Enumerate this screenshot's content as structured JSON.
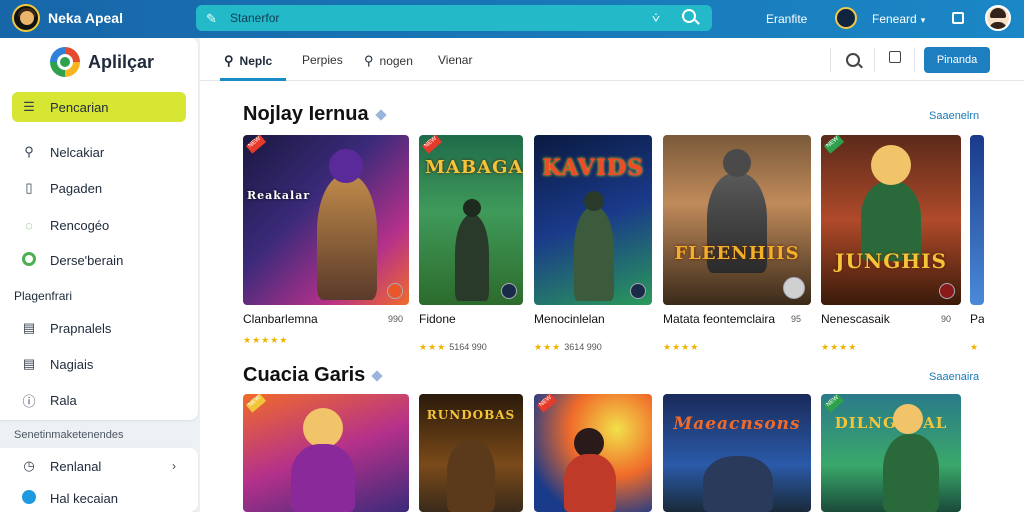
{
  "topbar": {
    "title": "Neka Apeal",
    "search_placeholder": "Stanerfor",
    "link": "Eranfite",
    "user": "Feneard"
  },
  "sidebar": {
    "brand": "Aplilçar",
    "items": [
      {
        "label": "Pencarian",
        "icon": "list-icon"
      },
      {
        "label": "Nelcakiar",
        "icon": "search-icon"
      },
      {
        "label": "Pagaden",
        "icon": "phone-icon"
      },
      {
        "label": "Rencogéo",
        "icon": "circle-icon"
      },
      {
        "label": "Derse'berain",
        "icon": "green-ring-icon"
      }
    ],
    "section1": "Plagenfrari",
    "items2": [
      {
        "label": "Prapnalels",
        "icon": "document-icon"
      },
      {
        "label": "Nagiais",
        "icon": "document-icon"
      },
      {
        "label": "Rala",
        "icon": "info-icon"
      }
    ],
    "section2": "Senetinmaketenendes",
    "items3": [
      {
        "label": "Renlanal",
        "icon": "clock-icon"
      },
      {
        "label": "Hal kecaian",
        "icon": "blue-dot-icon"
      }
    ]
  },
  "tabs": [
    {
      "label": "Neplc",
      "icon": "search-icon"
    },
    {
      "label": "Perpies",
      "icon": ""
    },
    {
      "label": "nogen",
      "icon": "search-icon"
    },
    {
      "label": "Vienar",
      "icon": ""
    }
  ],
  "main": {
    "action_button": "Pinanda",
    "section1_title": "Nojlay Iernua",
    "section1_see_all": "Saaenelrn",
    "section2_title": "Cuacia Garis",
    "section2_see_all": "Saaenaira"
  },
  "row1": [
    {
      "cover": "Reakalar",
      "name": "Clanbarlemna",
      "meta": "990",
      "stars": "★★★★★",
      "count": ""
    },
    {
      "cover": "MABAGAL",
      "name": "Fidone",
      "meta": "",
      "stars": "★★★",
      "count": "5164 990"
    },
    {
      "cover": "KAVIDS",
      "name": "Menocinlelan",
      "meta": "",
      "stars": "★★★",
      "count": "3614 990"
    },
    {
      "cover": "FLEENHIIS",
      "name": "Matata feontemclaira",
      "meta": "95",
      "stars": "★★★★",
      "count": ""
    },
    {
      "cover": "JUNGHIS",
      "name": "Nenescasaik",
      "meta": "90",
      "stars": "★★★★",
      "count": ""
    },
    {
      "cover": "",
      "name": "Pa",
      "meta": "",
      "stars": "★",
      "count": ""
    }
  ],
  "row2": [
    {
      "cover": ""
    },
    {
      "cover": "RUNDOBAS"
    },
    {
      "cover": ""
    },
    {
      "cover": "Maeacnsons"
    },
    {
      "cover": "DILNGAUAL"
    },
    {
      "cover": ""
    }
  ],
  "colors": {
    "topbar": "#1b87c6",
    "search": "#23b9c9",
    "active_item": "#d7e633",
    "accent": "#1d7ec0"
  }
}
